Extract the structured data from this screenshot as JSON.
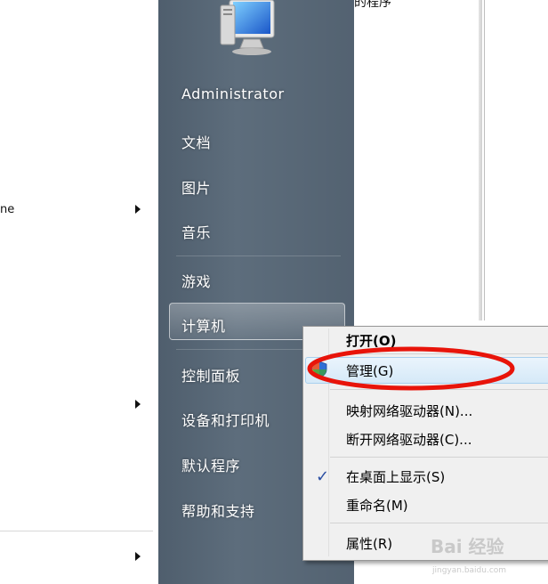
{
  "left_pane": {
    "fragment": "ne"
  },
  "user": {
    "name": "Administrator"
  },
  "start_menu": {
    "items": [
      {
        "label": "文档"
      },
      {
        "label": "图片"
      },
      {
        "label": "音乐"
      },
      {
        "label": "游戏"
      },
      {
        "label": "计算机"
      },
      {
        "label": "控制面板"
      },
      {
        "label": "设备和打印机"
      },
      {
        "label": "默认程序"
      },
      {
        "label": "帮助和支持"
      }
    ]
  },
  "background_window": {
    "title_fragment": "的程序"
  },
  "context_menu": {
    "items": [
      {
        "label": "打开(O)"
      },
      {
        "label": "管理(G)"
      },
      {
        "label": "映射网络驱动器(N)..."
      },
      {
        "label": "断开网络驱动器(C)..."
      },
      {
        "label": "在桌面上显示(S)"
      },
      {
        "label": "重命名(M)"
      },
      {
        "label": "属性(R)"
      }
    ],
    "highlighted": "管理(G)",
    "checked": "在桌面上显示(S)"
  },
  "watermark": {
    "text": "Bai 经验",
    "url": "jingyan.baidu.com"
  },
  "colors": {
    "dark_pane": "#56697a",
    "annotation_red": "#e8140a",
    "menu_highlight": "#d5e9f8"
  },
  "icons": {
    "avatar": "computer-monitor-icon",
    "manage": "uac-shield-icon",
    "checked": "checkmark-icon",
    "submenu": "triangle-right-icon"
  }
}
